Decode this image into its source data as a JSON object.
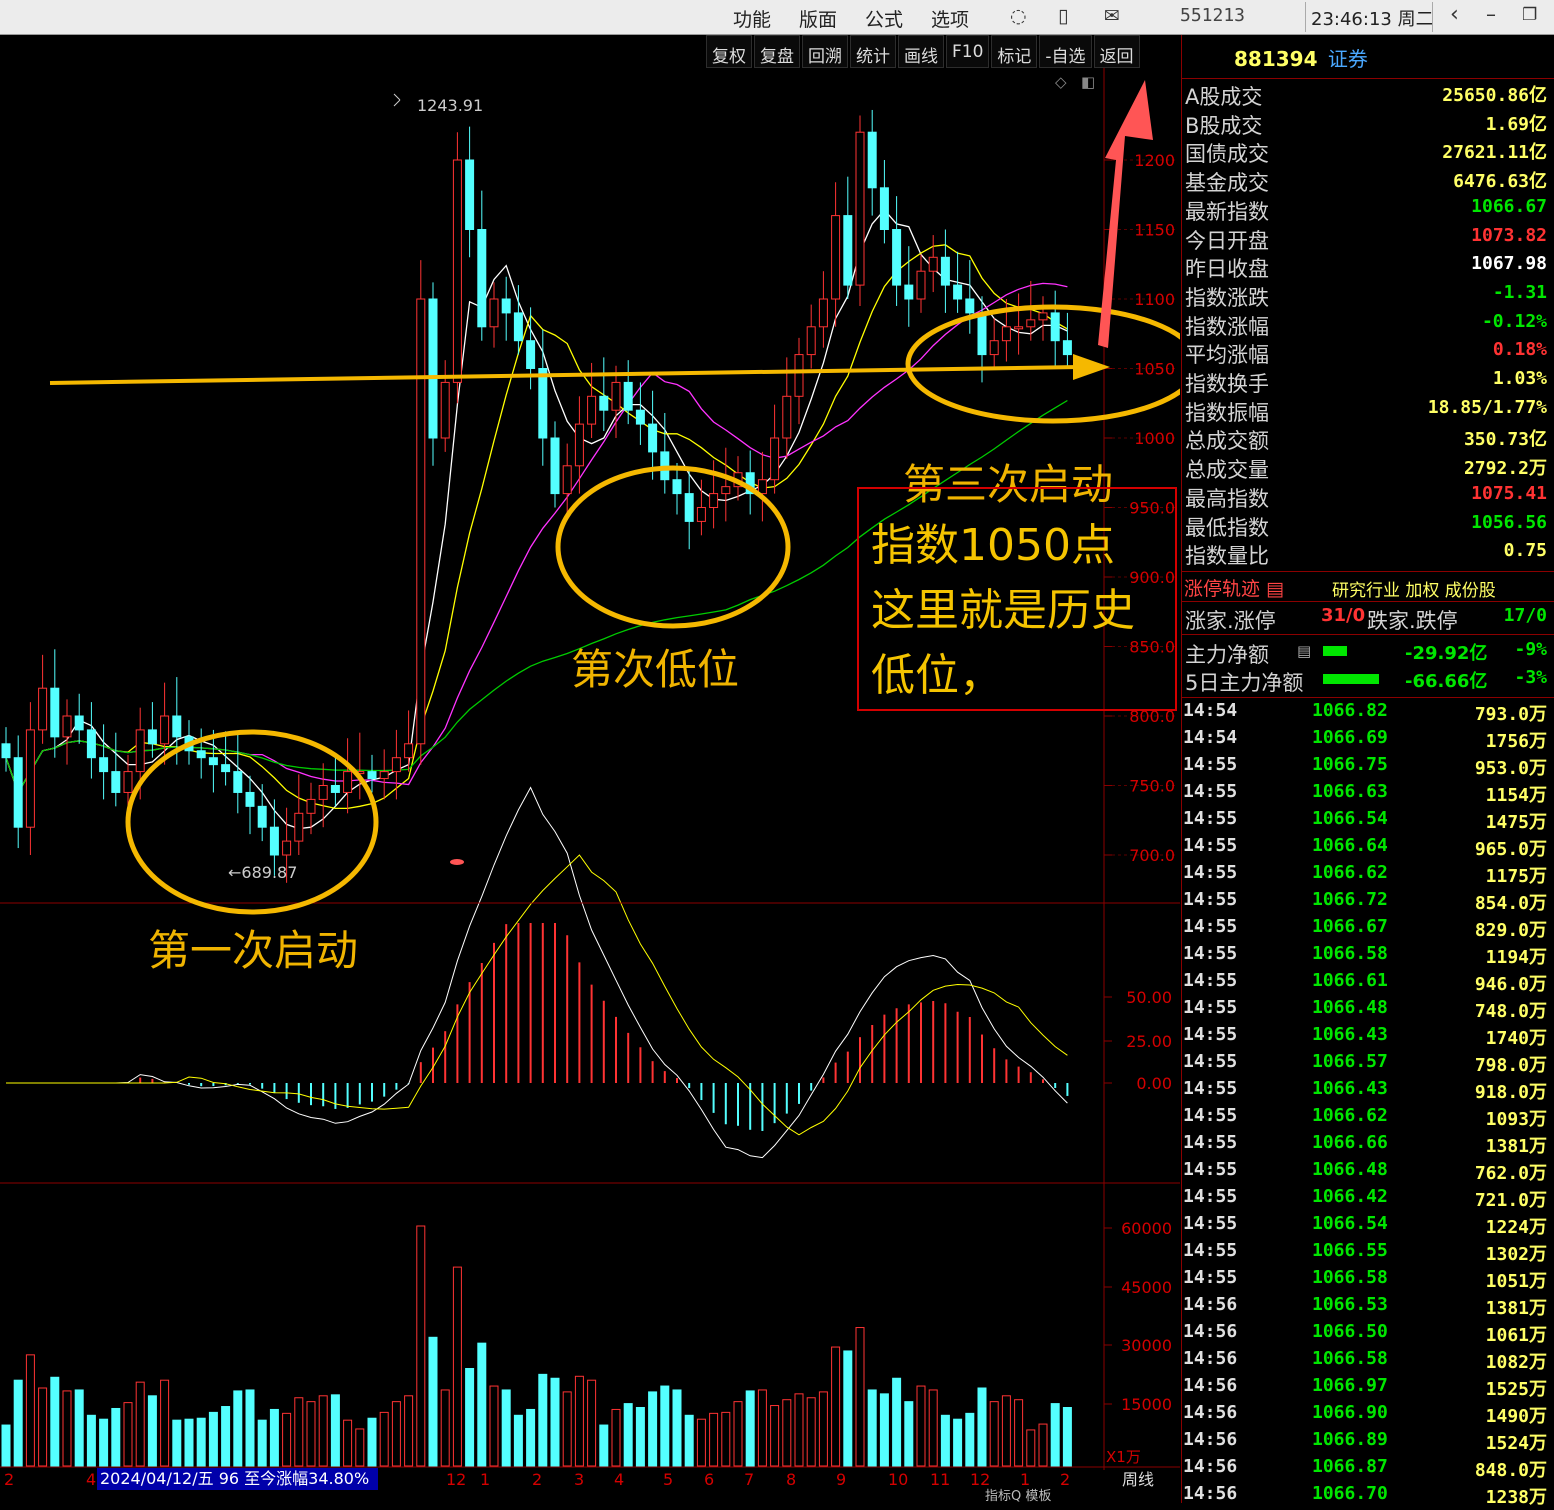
{
  "topbar": {
    "menu": [
      "功能",
      "版面",
      "公式",
      "选项"
    ],
    "code": "551213",
    "clock": "23:46:13 周二"
  },
  "toolbar": [
    "复权",
    "复盘",
    "回溯",
    "统计",
    "画线",
    "F10",
    "标记",
    "-自选",
    "返回"
  ],
  "panel": {
    "code": "881394",
    "name": "证券",
    "stats": [
      {
        "label": "A股成交",
        "value": "25650.86亿",
        "color": "#ffff66"
      },
      {
        "label": "B股成交",
        "value": "1.69亿",
        "color": "#ffff66"
      },
      {
        "label": "国债成交",
        "value": "27621.11亿",
        "color": "#ffff66"
      },
      {
        "label": "基金成交",
        "value": "6476.63亿",
        "color": "#ffff66"
      },
      {
        "label": "最新指数",
        "value": "1066.67",
        "color": "#00e600"
      },
      {
        "label": "今日开盘",
        "value": "1073.82",
        "color": "#ff3333"
      },
      {
        "label": "昨日收盘",
        "value": "1067.98",
        "color": "#ffffff"
      },
      {
        "label": "指数涨跌",
        "value": "-1.31",
        "color": "#00e600"
      },
      {
        "label": "指数涨幅",
        "value": "-0.12%",
        "color": "#00e600"
      },
      {
        "label": "平均涨幅",
        "value": "0.18%",
        "color": "#ff3333"
      },
      {
        "label": "指数换手",
        "value": "1.03%",
        "color": "#ffff66"
      },
      {
        "label": "指数振幅",
        "value": "18.85/1.77%",
        "color": "#ffff66"
      },
      {
        "label": "总成交额",
        "value": "350.73亿",
        "color": "#ffff66"
      },
      {
        "label": "总成交量",
        "value": "2792.2万",
        "color": "#ffff66"
      },
      {
        "label": "最高指数",
        "value": "1075.41",
        "color": "#ff3333"
      },
      {
        "label": "最低指数",
        "value": "1056.56",
        "color": "#00e600"
      },
      {
        "label": "指数量比",
        "value": "0.75",
        "color": "#ffff66"
      }
    ],
    "limit_bar": {
      "label": "涨停轨迹",
      "links": "研究行业 加权 成份股"
    },
    "breadth": {
      "up_label": "涨家.涨停",
      "up": "31/0",
      "down_label": "跌家.跌停",
      "down": "17/0"
    },
    "flows": [
      {
        "label": "主力净额",
        "value": "-29.92亿",
        "pct": "-9%"
      },
      {
        "label": "5日主力净额",
        "value": "-66.66亿",
        "pct": "-3%"
      }
    ],
    "ticks": [
      [
        "14:54",
        "1066.82",
        "793.0万"
      ],
      [
        "14:54",
        "1066.69",
        "1756万"
      ],
      [
        "14:55",
        "1066.75",
        "953.0万"
      ],
      [
        "14:55",
        "1066.63",
        "1154万"
      ],
      [
        "14:55",
        "1066.54",
        "1475万"
      ],
      [
        "14:55",
        "1066.64",
        "965.0万"
      ],
      [
        "14:55",
        "1066.62",
        "1175万"
      ],
      [
        "14:55",
        "1066.72",
        "854.0万"
      ],
      [
        "14:55",
        "1066.67",
        "829.0万"
      ],
      [
        "14:55",
        "1066.58",
        "1194万"
      ],
      [
        "14:55",
        "1066.61",
        "946.0万"
      ],
      [
        "14:55",
        "1066.48",
        "748.0万"
      ],
      [
        "14:55",
        "1066.43",
        "1740万"
      ],
      [
        "14:55",
        "1066.57",
        "798.0万"
      ],
      [
        "14:55",
        "1066.43",
        "918.0万"
      ],
      [
        "14:55",
        "1066.62",
        "1093万"
      ],
      [
        "14:55",
        "1066.66",
        "1381万"
      ],
      [
        "14:55",
        "1066.48",
        "762.0万"
      ],
      [
        "14:55",
        "1066.42",
        "721.0万"
      ],
      [
        "14:55",
        "1066.54",
        "1224万"
      ],
      [
        "14:55",
        "1066.55",
        "1302万"
      ],
      [
        "14:55",
        "1066.58",
        "1051万"
      ],
      [
        "14:56",
        "1066.53",
        "1381万"
      ],
      [
        "14:56",
        "1066.50",
        "1061万"
      ],
      [
        "14:56",
        "1066.58",
        "1082万"
      ],
      [
        "14:56",
        "1066.97",
        "1525万"
      ],
      [
        "14:56",
        "1066.90",
        "1490万"
      ],
      [
        "14:56",
        "1066.89",
        "1524万"
      ],
      [
        "14:56",
        "1066.87",
        "848.0万"
      ],
      [
        "14:56",
        "1066.70",
        "1238万"
      ]
    ]
  },
  "chart": {
    "price_axis": [
      "1200",
      "1150",
      "1100",
      "1050",
      "1000",
      "950.0",
      "900.0",
      "850.0",
      "800.0",
      "750.0",
      "700.0"
    ],
    "macd_axis": [
      "50.00",
      "25.00",
      "0.00"
    ],
    "vol_axis": [
      "60000",
      "45000",
      "30000",
      "15000"
    ],
    "vol_unit": "X1万",
    "high_label": "1243.91",
    "low_label": "689.87",
    "x_labels": [
      "2",
      "4",
      "12",
      "1",
      "2",
      "3",
      "4",
      "5",
      "6",
      "7",
      "8",
      "9",
      "10",
      "11",
      "12",
      "1",
      "2"
    ],
    "info": "2024/04/12/五 96 至今涨幅34.80%",
    "period": "周线",
    "bottom_tabs": "指标Q 模板"
  },
  "annotations": {
    "first": "第一次启动",
    "second": "第次低位",
    "third": "第三次启动",
    "box": [
      "指数1050点",
      "这里就是历史",
      "低位，"
    ]
  }
}
